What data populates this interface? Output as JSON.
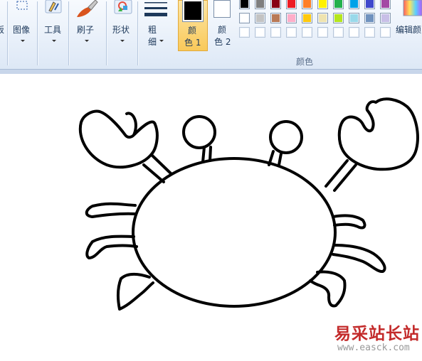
{
  "ribbon": {
    "clipboard_partial_label": "板",
    "image_label": "图像",
    "tools_label": "工具",
    "brushes_label": "刷子",
    "shapes_label": "形状",
    "size_label_line1": "粗",
    "size_label_line2": "细",
    "color1_line1": "颜",
    "color1_line2": "色 1",
    "color2_line1": "颜",
    "color2_line2": "色 2",
    "colors_group_label": "颜色",
    "edit_colors_label": "编辑颜"
  },
  "colors": {
    "color1": "#000000",
    "color2": "#ffffff",
    "palette_row1": [
      "#000000",
      "#7f7f7f",
      "#880015",
      "#ed1c24",
      "#ff7f27",
      "#fff200",
      "#22b14c",
      "#00a2e8",
      "#3f48cc",
      "#a349a4"
    ],
    "palette_row2": [
      "#ffffff",
      "#c3c3c3",
      "#b97a57",
      "#ffaec9",
      "#ffc90e",
      "#efe4b0",
      "#b5e61d",
      "#99d9ea",
      "#7092be",
      "#c8bfe7"
    ],
    "palette_row3": [
      "#ffffff",
      "#ffffff",
      "#ffffff",
      "#ffffff",
      "#ffffff",
      "#ffffff",
      "#ffffff",
      "#ffffff",
      "#ffffff",
      "#ffffff"
    ]
  },
  "watermark": {
    "title": "易采站长站",
    "url": "www.easck.com"
  }
}
